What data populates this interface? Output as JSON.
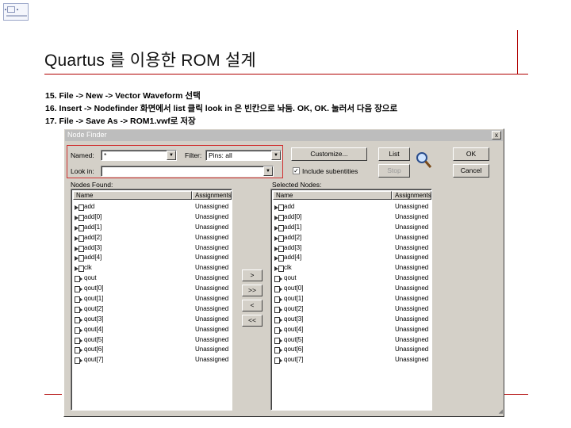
{
  "slide": {
    "title": "Quartus 를 이용한 ROM 설계",
    "steps": [
      "15. File -> New -> Vector Waveform 선택",
      "16. Insert -> Nodefinder 화면에서 list 클릭 look in 은 빈칸으로 놔둠.  OK, OK. 눌러서 다음 장으로",
      "17. File -> Save As -> ROM1.vwf로 저장"
    ]
  },
  "dialog": {
    "title": "Node Finder",
    "close_glyph": "x",
    "named_label": "Named:",
    "named_value": "*",
    "filter_label": "Filter:",
    "filter_value": "Pins: all",
    "lookin_label": "Look in:",
    "lookin_value": "",
    "include_subentities_label": "Include subentities",
    "include_subentities_checked": true,
    "customize_button": "Customize...",
    "list_button": "List",
    "stop_button": "Stop",
    "ok_button": "OK",
    "cancel_button": "Cancel",
    "nodes_found_label": "Nodes Found:",
    "selected_nodes_label": "Selected Nodes:",
    "col_name": "Name",
    "col_assignments": "Assignments",
    "move_buttons": [
      ">",
      ">>",
      "<",
      "<<"
    ],
    "icon_names": {
      "node_input": "input-pin-icon",
      "node_output": "output-pin-icon",
      "search": "magnifier-search-icon"
    }
  },
  "nodes_found": [
    {
      "name": "add",
      "assignment": "Unassigned",
      "icon": "input-pin-icon"
    },
    {
      "name": "add[0]",
      "assignment": "Unassigned",
      "icon": "input-pin-icon"
    },
    {
      "name": "add[1]",
      "assignment": "Unassigned",
      "icon": "input-pin-icon"
    },
    {
      "name": "add[2]",
      "assignment": "Unassigned",
      "icon": "input-pin-icon"
    },
    {
      "name": "add[3]",
      "assignment": "Unassigned",
      "icon": "input-pin-icon"
    },
    {
      "name": "add[4]",
      "assignment": "Unassigned",
      "icon": "input-pin-icon"
    },
    {
      "name": "clk",
      "assignment": "Unassigned",
      "icon": "input-pin-icon"
    },
    {
      "name": "qout",
      "assignment": "Unassigned",
      "icon": "output-pin-icon"
    },
    {
      "name": "qout[0]",
      "assignment": "Unassigned",
      "icon": "output-pin-icon"
    },
    {
      "name": "qout[1]",
      "assignment": "Unassigned",
      "icon": "output-pin-icon"
    },
    {
      "name": "qout[2]",
      "assignment": "Unassigned",
      "icon": "output-pin-icon"
    },
    {
      "name": "qout[3]",
      "assignment": "Unassigned",
      "icon": "output-pin-icon"
    },
    {
      "name": "qout[4]",
      "assignment": "Unassigned",
      "icon": "output-pin-icon"
    },
    {
      "name": "qout[5]",
      "assignment": "Unassigned",
      "icon": "output-pin-icon"
    },
    {
      "name": "qout[6]",
      "assignment": "Unassigned",
      "icon": "output-pin-icon"
    },
    {
      "name": "qout[7]",
      "assignment": "Unassigned",
      "icon": "output-pin-icon"
    }
  ],
  "selected_nodes": [
    {
      "name": "add",
      "assignment": "Unassigned",
      "icon": "input-pin-icon"
    },
    {
      "name": "add[0]",
      "assignment": "Unassigned",
      "icon": "input-pin-icon"
    },
    {
      "name": "add[1]",
      "assignment": "Unassigned",
      "icon": "input-pin-icon"
    },
    {
      "name": "add[2]",
      "assignment": "Unassigned",
      "icon": "input-pin-icon"
    },
    {
      "name": "add[3]",
      "assignment": "Unassigned",
      "icon": "input-pin-icon"
    },
    {
      "name": "add[4]",
      "assignment": "Unassigned",
      "icon": "input-pin-icon"
    },
    {
      "name": "clk",
      "assignment": "Unassigned",
      "icon": "input-pin-icon"
    },
    {
      "name": "qout",
      "assignment": "Unassigned",
      "icon": "output-pin-icon"
    },
    {
      "name": "qout[0]",
      "assignment": "Unassigned",
      "icon": "output-pin-icon"
    },
    {
      "name": "qout[1]",
      "assignment": "Unassigned",
      "icon": "output-pin-icon"
    },
    {
      "name": "qout[2]",
      "assignment": "Unassigned",
      "icon": "output-pin-icon"
    },
    {
      "name": "qout[3]",
      "assignment": "Unassigned",
      "icon": "output-pin-icon"
    },
    {
      "name": "qout[4]",
      "assignment": "Unassigned",
      "icon": "output-pin-icon"
    },
    {
      "name": "qout[5]",
      "assignment": "Unassigned",
      "icon": "output-pin-icon"
    },
    {
      "name": "qout[6]",
      "assignment": "Unassigned",
      "icon": "output-pin-icon"
    },
    {
      "name": "qout[7]",
      "assignment": "Unassigned",
      "icon": "output-pin-icon"
    }
  ]
}
